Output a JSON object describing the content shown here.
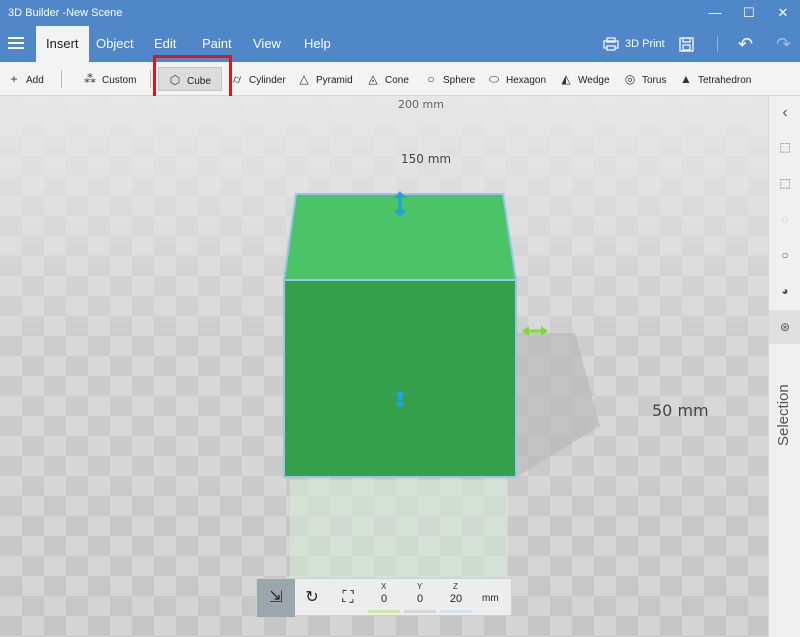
{
  "window": {
    "title": "3D Builder -New Scene",
    "controls": {
      "minimize": "—",
      "maximize": "☐",
      "close": "✕"
    }
  },
  "menu": {
    "tabs": [
      "Insert",
      "Object",
      "Edit",
      "Paint",
      "View",
      "Help"
    ],
    "active_tab": "Insert",
    "print_label": "3D Print"
  },
  "toolbar": {
    "add_label": "Add",
    "custom_label": "Custom",
    "shapes": [
      "Cube",
      "Cylinder",
      "Pyramid",
      "Cone",
      "Sphere",
      "Hexagon",
      "Wedge",
      "Torus",
      "Tetrahedron"
    ],
    "selected_shape": "Cube"
  },
  "scene": {
    "dimension_labels": [
      "200 mm",
      "150 mm",
      "50 mm"
    ],
    "colors": {
      "cube_top": "#4bc367",
      "cube_front": "#34a04c",
      "selection_outline": "#8fc7ee",
      "arrow_blue": "#1ea3e6",
      "arrow_green": "#7ddc33"
    }
  },
  "right_panel": {
    "selection_label": "Selection",
    "icons": [
      "collapse-arrow-icon",
      "select-all-icon",
      "select-none-icon",
      "invert-selection-icon",
      "circle-select-icon",
      "object-select-icon",
      "triangle-select-icon"
    ]
  },
  "transform": {
    "x_label": "X",
    "y_label": "Y",
    "z_label": "Z",
    "x": "0",
    "y": "0",
    "z": "20",
    "unit": "mm",
    "modes": [
      "move-icon",
      "rotate-icon",
      "scale-icon"
    ]
  }
}
